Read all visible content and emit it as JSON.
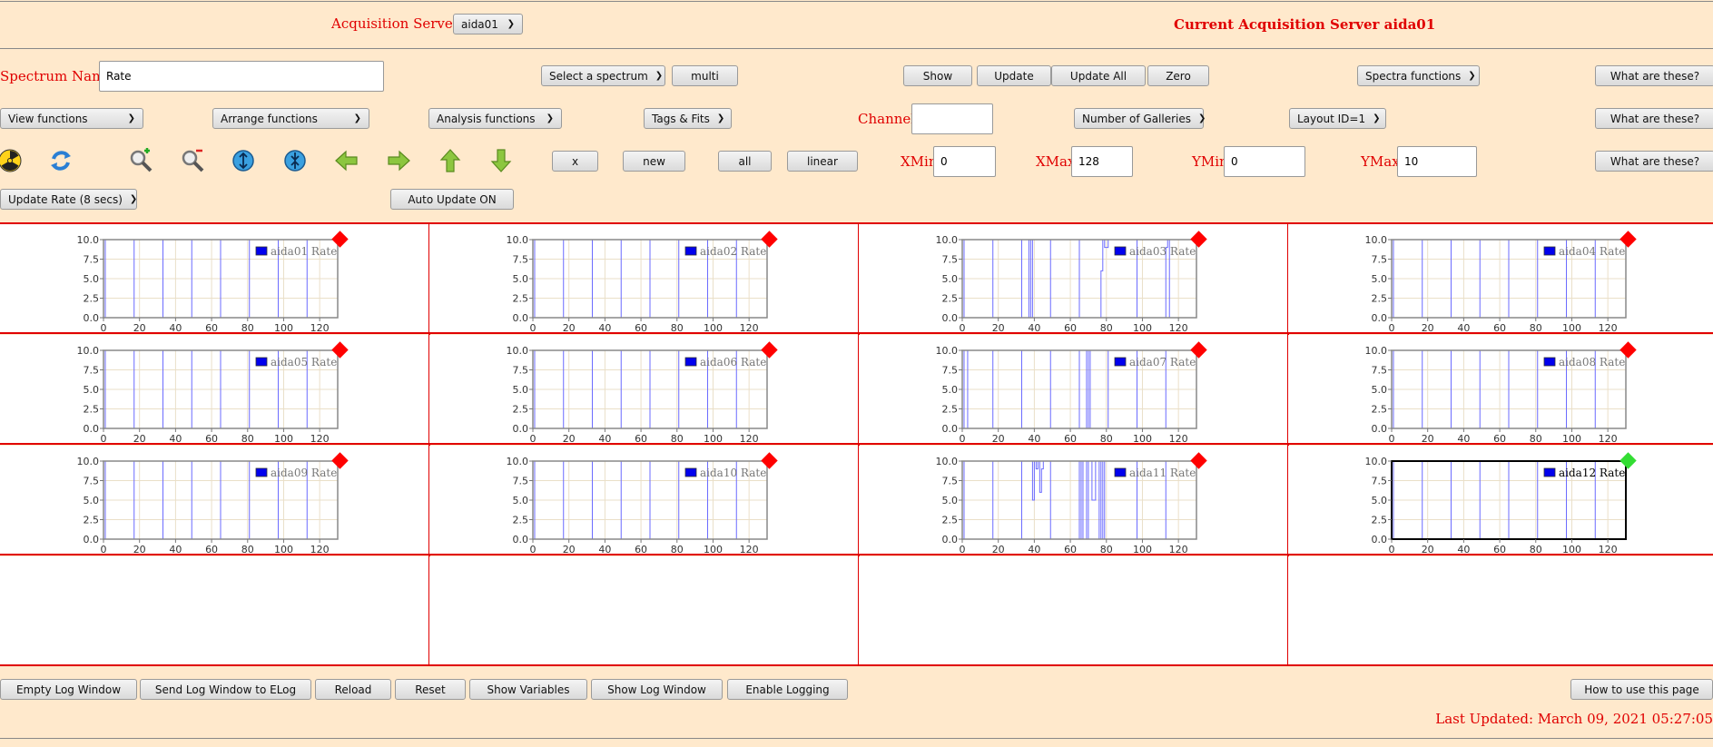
{
  "header": {
    "servers_label": "Acquisition Servers",
    "server_selected": "aida01",
    "current_server_text": "Current Acquisition Server aida01"
  },
  "row1": {
    "spectrum_name_label": "Spectrum Name:",
    "spectrum_name_value": "Rate",
    "select_spectrum": "Select a spectrum",
    "multi": "multi",
    "show": "Show",
    "update": "Update",
    "update_all": "Update All",
    "zero": "Zero",
    "spectra_functions": "Spectra functions",
    "what": "What are these?"
  },
  "row2": {
    "view_functions": "View functions",
    "arrange_functions": "Arrange functions",
    "analysis_functions": "Analysis functions",
    "tags_fits": "Tags & Fits",
    "channel_label": "Channel:",
    "channel_value": "",
    "galleries": "Number of Galleries",
    "layout": "Layout ID=1",
    "what": "What are these?"
  },
  "row3": {
    "icons": [
      "radiation-icon",
      "refresh-icon",
      "zoom-in-icon",
      "zoom-out-icon",
      "expand-y-icon",
      "compress-y-icon",
      "arrow-left-icon",
      "arrow-right-icon",
      "arrow-up-icon",
      "arrow-down-icon"
    ],
    "x": "x",
    "new": "new",
    "all": "all",
    "linear": "linear",
    "xmin_label": "XMin",
    "xmin": "0",
    "xmax_label": "XMax",
    "xmax": "128",
    "ymin_label": "YMin",
    "ymin": "0",
    "ymax_label": "YMax",
    "ymax": "10",
    "what": "What are these?"
  },
  "row4": {
    "update_rate": "Update Rate (8 secs)",
    "auto_update": "Auto Update ON"
  },
  "chart_data": {
    "type": "line",
    "xlim": [
      0,
      130
    ],
    "ylim": [
      0,
      10
    ],
    "x_ticks": [
      "0",
      "20",
      "40",
      "60",
      "80",
      "100",
      "120"
    ],
    "y_ticks": [
      "0.0",
      "2.5",
      "5.0",
      "7.5",
      "10.0"
    ],
    "grid": true,
    "legend_placement": "top-right",
    "status_colors": {
      "stale": "#ff0000",
      "current": "#33dd33"
    },
    "panels": [
      {
        "name": "aida01 Rate",
        "status": "stale",
        "segments": [
          [
            0,
            1,
            0
          ],
          [
            1,
            17,
            10
          ],
          [
            17,
            33,
            0
          ],
          [
            33,
            49,
            10
          ],
          [
            49,
            65,
            0
          ],
          [
            65,
            81,
            10
          ],
          [
            81,
            97,
            0
          ],
          [
            97,
            113,
            10
          ],
          [
            113,
            129,
            0
          ]
        ]
      },
      {
        "name": "aida02 Rate",
        "status": "stale",
        "segments": [
          [
            0,
            1,
            0
          ],
          [
            1,
            17,
            10
          ],
          [
            17,
            33,
            0
          ],
          [
            33,
            49,
            10
          ],
          [
            49,
            65,
            0
          ],
          [
            65,
            81,
            10
          ],
          [
            81,
            97,
            0
          ],
          [
            97,
            113,
            10
          ],
          [
            113,
            129,
            0
          ]
        ]
      },
      {
        "name": "aida03 Rate",
        "status": "stale",
        "segments": [
          [
            0,
            1,
            0
          ],
          [
            1,
            17,
            10
          ],
          [
            17,
            33,
            0
          ],
          [
            33,
            37,
            10
          ],
          [
            37,
            38,
            0
          ],
          [
            38,
            39,
            10
          ],
          [
            39,
            49,
            0
          ],
          [
            49,
            65,
            10
          ],
          [
            65,
            77,
            0
          ],
          [
            77,
            78,
            6
          ],
          [
            78,
            79,
            10
          ],
          [
            79,
            81,
            9
          ],
          [
            81,
            97,
            10
          ],
          [
            97,
            113,
            0
          ],
          [
            113,
            114,
            9
          ],
          [
            114,
            115,
            10
          ],
          [
            115,
            129,
            0
          ]
        ]
      },
      {
        "name": "aida04 Rate",
        "status": "stale",
        "segments": [
          [
            0,
            1,
            0
          ],
          [
            1,
            17,
            10
          ],
          [
            17,
            33,
            0
          ],
          [
            33,
            49,
            10
          ],
          [
            49,
            65,
            0
          ],
          [
            65,
            81,
            10
          ],
          [
            81,
            97,
            0
          ],
          [
            97,
            113,
            10
          ],
          [
            113,
            129,
            0
          ]
        ]
      },
      {
        "name": "aida05 Rate",
        "status": "stale",
        "segments": [
          [
            0,
            1,
            0
          ],
          [
            1,
            17,
            10
          ],
          [
            17,
            33,
            0
          ],
          [
            33,
            49,
            10
          ],
          [
            49,
            65,
            0
          ],
          [
            65,
            81,
            10
          ],
          [
            81,
            97,
            0
          ],
          [
            97,
            113,
            10
          ],
          [
            113,
            129,
            0
          ]
        ]
      },
      {
        "name": "aida06 Rate",
        "status": "stale",
        "segments": [
          [
            0,
            1,
            0
          ],
          [
            1,
            17,
            10
          ],
          [
            17,
            33,
            0
          ],
          [
            33,
            49,
            10
          ],
          [
            49,
            65,
            0
          ],
          [
            65,
            81,
            10
          ],
          [
            81,
            97,
            0
          ],
          [
            97,
            113,
            10
          ],
          [
            113,
            129,
            0
          ]
        ]
      },
      {
        "name": "aida07 Rate",
        "status": "stale",
        "segments": [
          [
            0,
            1,
            10
          ],
          [
            1,
            3,
            0
          ],
          [
            3,
            6,
            10
          ],
          [
            6,
            17,
            10
          ],
          [
            17,
            33,
            0
          ],
          [
            33,
            49,
            10
          ],
          [
            49,
            65,
            0
          ],
          [
            65,
            69,
            10
          ],
          [
            69,
            70,
            0
          ],
          [
            70,
            71,
            10
          ],
          [
            71,
            81,
            0
          ],
          [
            81,
            97,
            10
          ],
          [
            97,
            113,
            0
          ],
          [
            113,
            129,
            10
          ]
        ]
      },
      {
        "name": "aida08 Rate",
        "status": "stale",
        "segments": [
          [
            0,
            1,
            0
          ],
          [
            1,
            17,
            10
          ],
          [
            17,
            33,
            0
          ],
          [
            33,
            49,
            10
          ],
          [
            49,
            65,
            0
          ],
          [
            65,
            81,
            10
          ],
          [
            81,
            97,
            0
          ],
          [
            97,
            113,
            10
          ],
          [
            113,
            129,
            0
          ]
        ]
      },
      {
        "name": "aida09 Rate",
        "status": "stale",
        "segments": [
          [
            0,
            1,
            0
          ],
          [
            1,
            17,
            10
          ],
          [
            17,
            33,
            0
          ],
          [
            33,
            49,
            10
          ],
          [
            49,
            65,
            0
          ],
          [
            65,
            81,
            10
          ],
          [
            81,
            97,
            0
          ],
          [
            97,
            113,
            10
          ],
          [
            113,
            129,
            0
          ]
        ]
      },
      {
        "name": "aida10 Rate",
        "status": "stale",
        "segments": [
          [
            0,
            1,
            0
          ],
          [
            1,
            17,
            10
          ],
          [
            17,
            33,
            0
          ],
          [
            33,
            49,
            10
          ],
          [
            49,
            65,
            0
          ],
          [
            65,
            81,
            10
          ],
          [
            81,
            97,
            0
          ],
          [
            97,
            113,
            10
          ],
          [
            113,
            129,
            0
          ]
        ]
      },
      {
        "name": "aida11 Rate",
        "status": "stale",
        "segments": [
          [
            0,
            1,
            0
          ],
          [
            1,
            17,
            10
          ],
          [
            17,
            33,
            0
          ],
          [
            33,
            39,
            10
          ],
          [
            39,
            40,
            5
          ],
          [
            40,
            41,
            10
          ],
          [
            41,
            42,
            9
          ],
          [
            42,
            43,
            10
          ],
          [
            43,
            44,
            6
          ],
          [
            44,
            45,
            9
          ],
          [
            45,
            49,
            10
          ],
          [
            49,
            65,
            0
          ],
          [
            65,
            66,
            10
          ],
          [
            66,
            67,
            0
          ],
          [
            67,
            69,
            10
          ],
          [
            69,
            70,
            0
          ],
          [
            70,
            72,
            10
          ],
          [
            72,
            74,
            5
          ],
          [
            74,
            76,
            10
          ],
          [
            76,
            77,
            0
          ],
          [
            77,
            78,
            10
          ],
          [
            78,
            79,
            0
          ],
          [
            79,
            81,
            10
          ],
          [
            81,
            97,
            10
          ],
          [
            97,
            113,
            0
          ],
          [
            113,
            129,
            10
          ]
        ]
      },
      {
        "name": "aida12 Rate",
        "status": "current",
        "segments": [
          [
            0,
            1,
            0
          ],
          [
            1,
            17,
            10
          ],
          [
            17,
            33,
            0
          ],
          [
            33,
            49,
            10
          ],
          [
            49,
            65,
            0
          ],
          [
            65,
            81,
            10
          ],
          [
            81,
            97,
            0
          ],
          [
            97,
            113,
            10
          ],
          [
            113,
            129,
            0
          ]
        ]
      }
    ]
  },
  "footer": {
    "empty_log": "Empty Log Window",
    "send_log": "Send Log Window to ELog",
    "reload": "Reload",
    "reset": "Reset",
    "show_vars": "Show Variables",
    "show_log": "Show Log Window",
    "enable_logging": "Enable Logging",
    "how_to": "How to use this page",
    "last_updated": "Last Updated: March 09, 2021 05:27:05"
  }
}
